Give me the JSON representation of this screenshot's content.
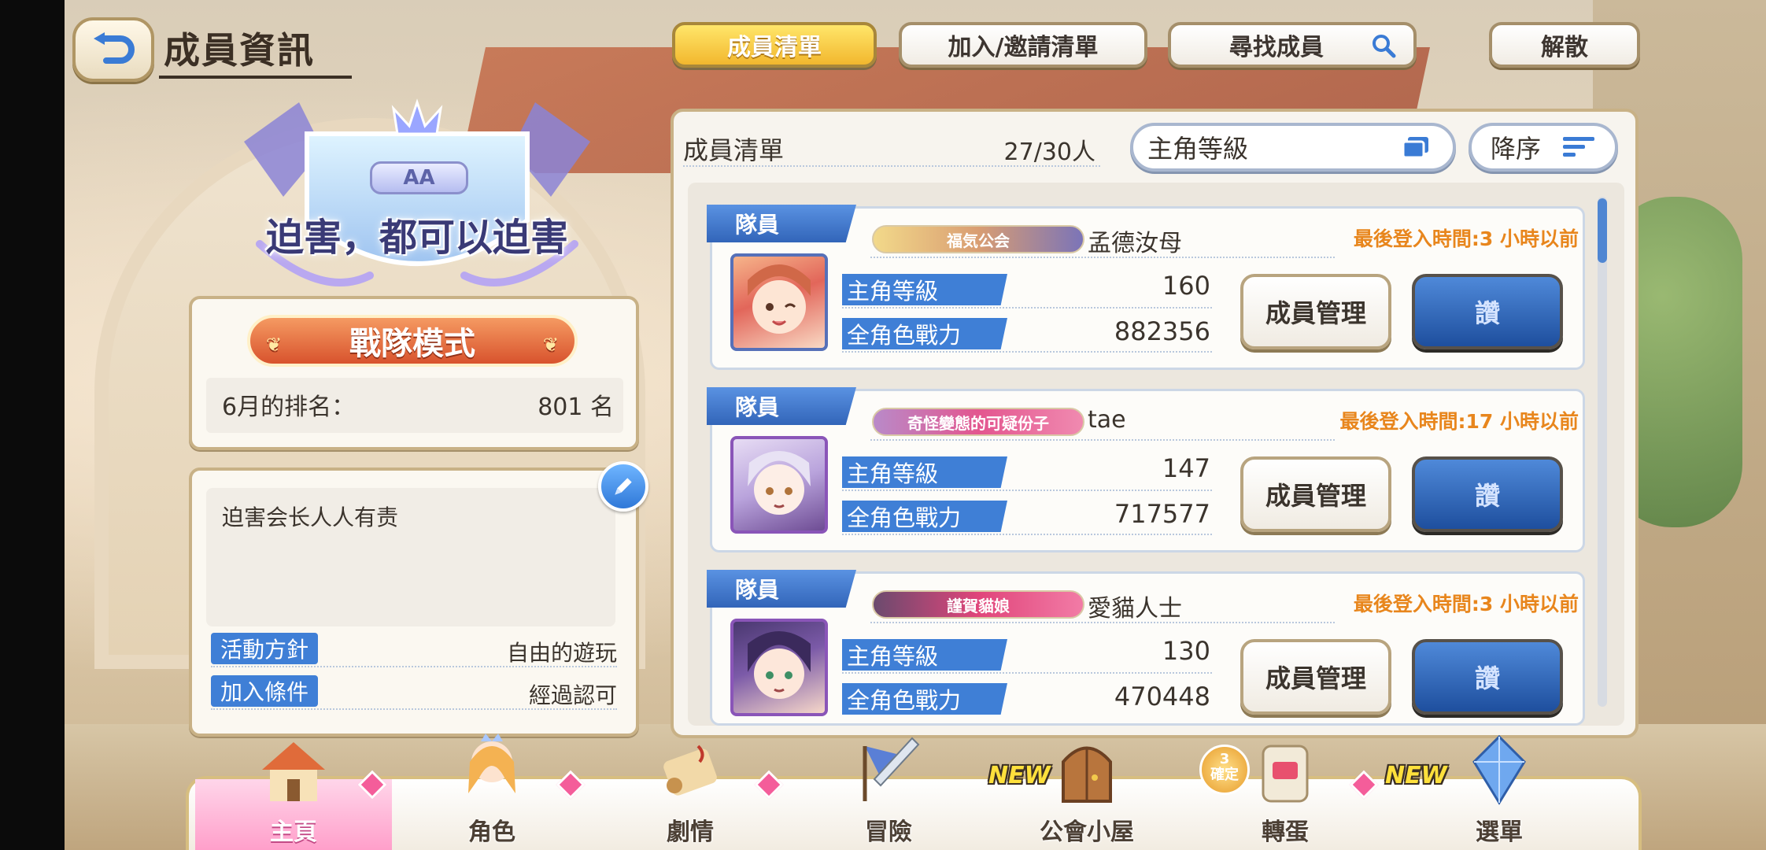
{
  "header": {
    "title": "成員資訊",
    "tabs": [
      {
        "label": "成員清單",
        "active": true
      },
      {
        "label": "加入/邀請清單",
        "active": false
      },
      {
        "label": "尋找成員",
        "active": false
      },
      {
        "label": "解散",
        "active": false
      }
    ]
  },
  "clan": {
    "rank_badge": "AA",
    "name": "迫害，都可以迫害",
    "mode": "戰隊模式",
    "ranking_label": "6月的排名：",
    "ranking_value": "801 名",
    "description": "迫害会长人人有责",
    "policy_label": "活動方針",
    "policy_value": "自由的遊玩",
    "join_label": "加入條件",
    "join_value": "經過認可"
  },
  "member_list": {
    "title": "成員清單",
    "count": "27/30人",
    "sort_field": "主角等級",
    "sort_order": "降序",
    "stat1_label": "主角等級",
    "stat2_label": "全角色戰力",
    "manage_label": "成員管理",
    "like_label": "讚",
    "members": [
      {
        "role": "隊員",
        "badge": "福気公会",
        "name": "孟德汝母",
        "last_login": "最後登入時間:3 小時以前",
        "level": "160",
        "power": "882356"
      },
      {
        "role": "隊員",
        "badge": "奇怪變態的可疑份子",
        "name": "tae",
        "last_login": "最後登入時間:17 小時以前",
        "level": "147",
        "power": "717577"
      },
      {
        "role": "隊員",
        "badge": "謹賀貓娘",
        "name": "愛貓人士",
        "last_login": "最後登入時間:3 小時以前",
        "level": "130",
        "power": "470448"
      }
    ]
  },
  "bottom_nav": [
    {
      "label": "主頁",
      "active": true
    },
    {
      "label": "角色"
    },
    {
      "label": "劇情"
    },
    {
      "label": "冒險"
    },
    {
      "label": "公會小屋",
      "new": "NEW"
    },
    {
      "label": "轉蛋",
      "star_text": "3",
      "star_sub": "確定"
    },
    {
      "label": "選單",
      "new": "NEW"
    }
  ],
  "colors": {
    "accent_blue": "#3f7fd6",
    "login_orange": "#e8861d",
    "active_tab_gold": "#f2b72e",
    "mode_orange": "#d8532d"
  }
}
